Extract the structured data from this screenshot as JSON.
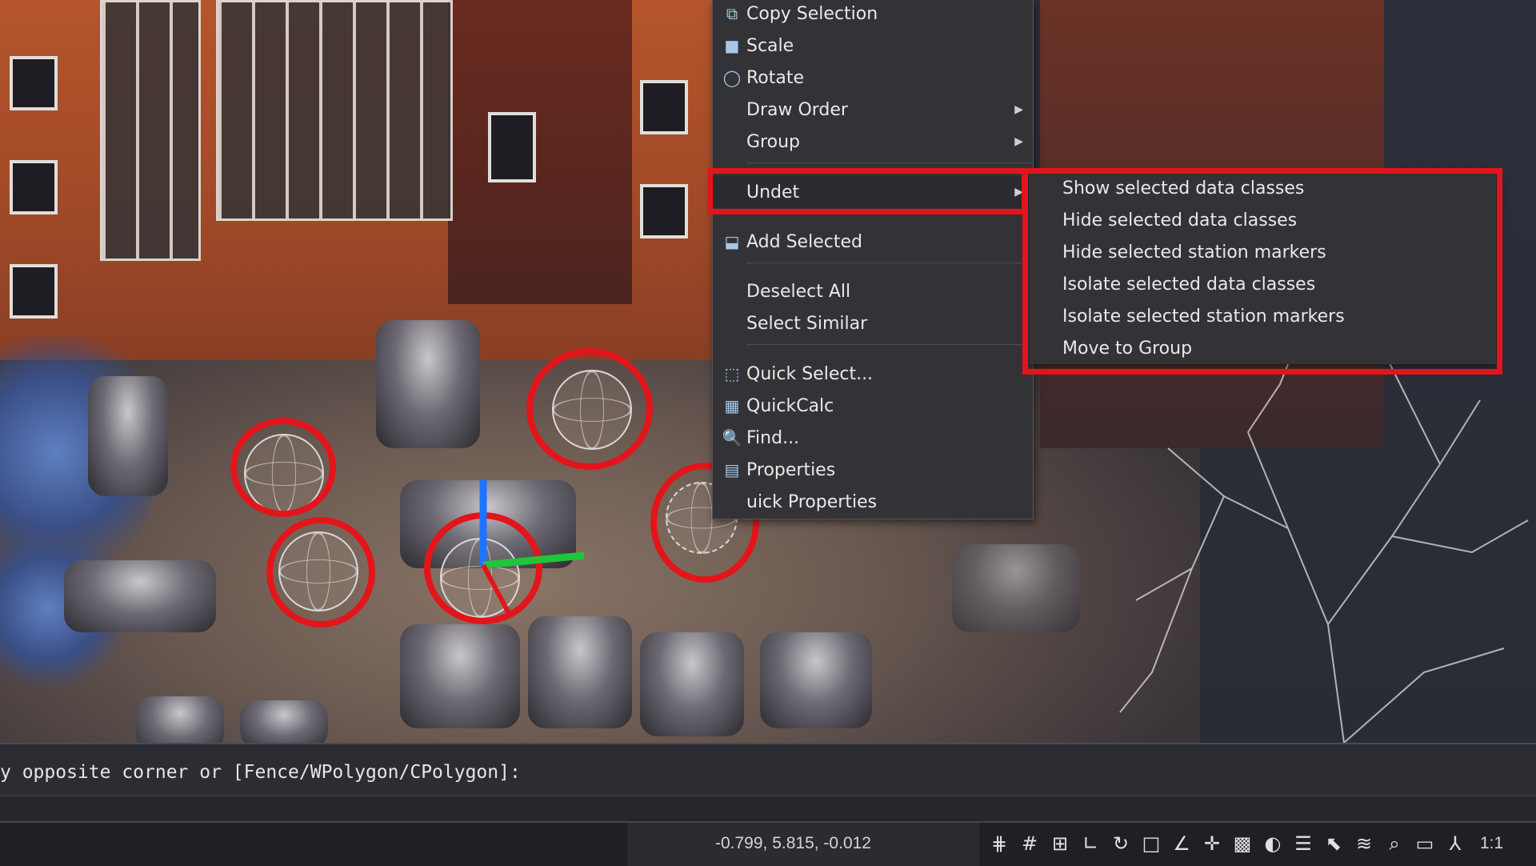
{
  "context_menu": {
    "items": [
      {
        "label": "Copy Selection",
        "icon": "copy-selection-icon",
        "glyph": "⧉"
      },
      {
        "label": "Scale",
        "icon": "scale-icon",
        "glyph": "■"
      },
      {
        "label": "Rotate",
        "icon": "rotate-icon",
        "glyph": "◯"
      },
      {
        "label": "Draw Order",
        "icon": "",
        "glyph": "",
        "submenu": true
      },
      {
        "label": "Group",
        "icon": "",
        "glyph": "",
        "submenu": true
      },
      {
        "label": "Undet",
        "icon": "",
        "glyph": "",
        "submenu": true
      },
      {
        "label": "Add Selected",
        "icon": "add-selected-icon",
        "glyph": "⬓"
      },
      {
        "label": "Deselect All",
        "icon": "",
        "glyph": ""
      },
      {
        "label": "Select Similar",
        "icon": "",
        "glyph": ""
      },
      {
        "label": "Quick Select...",
        "icon": "quick-select-icon",
        "glyph": "⬚"
      },
      {
        "label": "QuickCalc",
        "icon": "calculator-icon",
        "glyph": "▦"
      },
      {
        "label": "Find...",
        "icon": "find-icon",
        "glyph": "🔍"
      },
      {
        "label": "Properties",
        "icon": "properties-icon",
        "glyph": "▤"
      },
      {
        "label": "uick Properties",
        "icon": "",
        "glyph": ""
      }
    ],
    "submenu_arrow": "▶"
  },
  "undet_submenu": {
    "items": [
      "Show selected data classes",
      "Hide selected data classes",
      "Hide selected station markers",
      "Isolate selected data classes",
      "Isolate selected station markers",
      "Move to Group"
    ]
  },
  "command_line": {
    "prompt": "y opposite corner or [Fence/WPolygon/CPolygon]:",
    "input_value": ""
  },
  "status_bar": {
    "coordinates": "-0.799, 5.815, -0.012",
    "tools": [
      {
        "icon": "snap-grid-icon",
        "glyph": "⋕"
      },
      {
        "icon": "grid-icon",
        "glyph": "#"
      },
      {
        "icon": "snap-mode-icon",
        "glyph": "⊞"
      },
      {
        "icon": "ortho-icon",
        "glyph": "∟"
      },
      {
        "icon": "polar-tracking-icon",
        "glyph": "↻"
      },
      {
        "icon": "object-snap-icon",
        "glyph": "□"
      },
      {
        "icon": "dynamic-ucs-icon",
        "glyph": "∠"
      },
      {
        "icon": "dynamic-input-icon",
        "glyph": "✛"
      },
      {
        "icon": "lineweight-icon",
        "glyph": "▩"
      },
      {
        "icon": "transparency-icon",
        "glyph": "◐"
      },
      {
        "icon": "selection-cycling-icon",
        "glyph": "☰"
      },
      {
        "icon": "gizmo-icon",
        "glyph": "⬉"
      },
      {
        "icon": "layers-icon",
        "glyph": "≋"
      },
      {
        "icon": "zoom-icon",
        "glyph": "⌕"
      },
      {
        "icon": "workspace-icon",
        "glyph": "▭"
      },
      {
        "icon": "annotation-scale-icon",
        "glyph": "⅄"
      }
    ],
    "scale": "1:1"
  },
  "colors": {
    "highlight_red": "#e3151b",
    "menu_bg": "#333337",
    "menu_text": "#e9e9e9"
  }
}
